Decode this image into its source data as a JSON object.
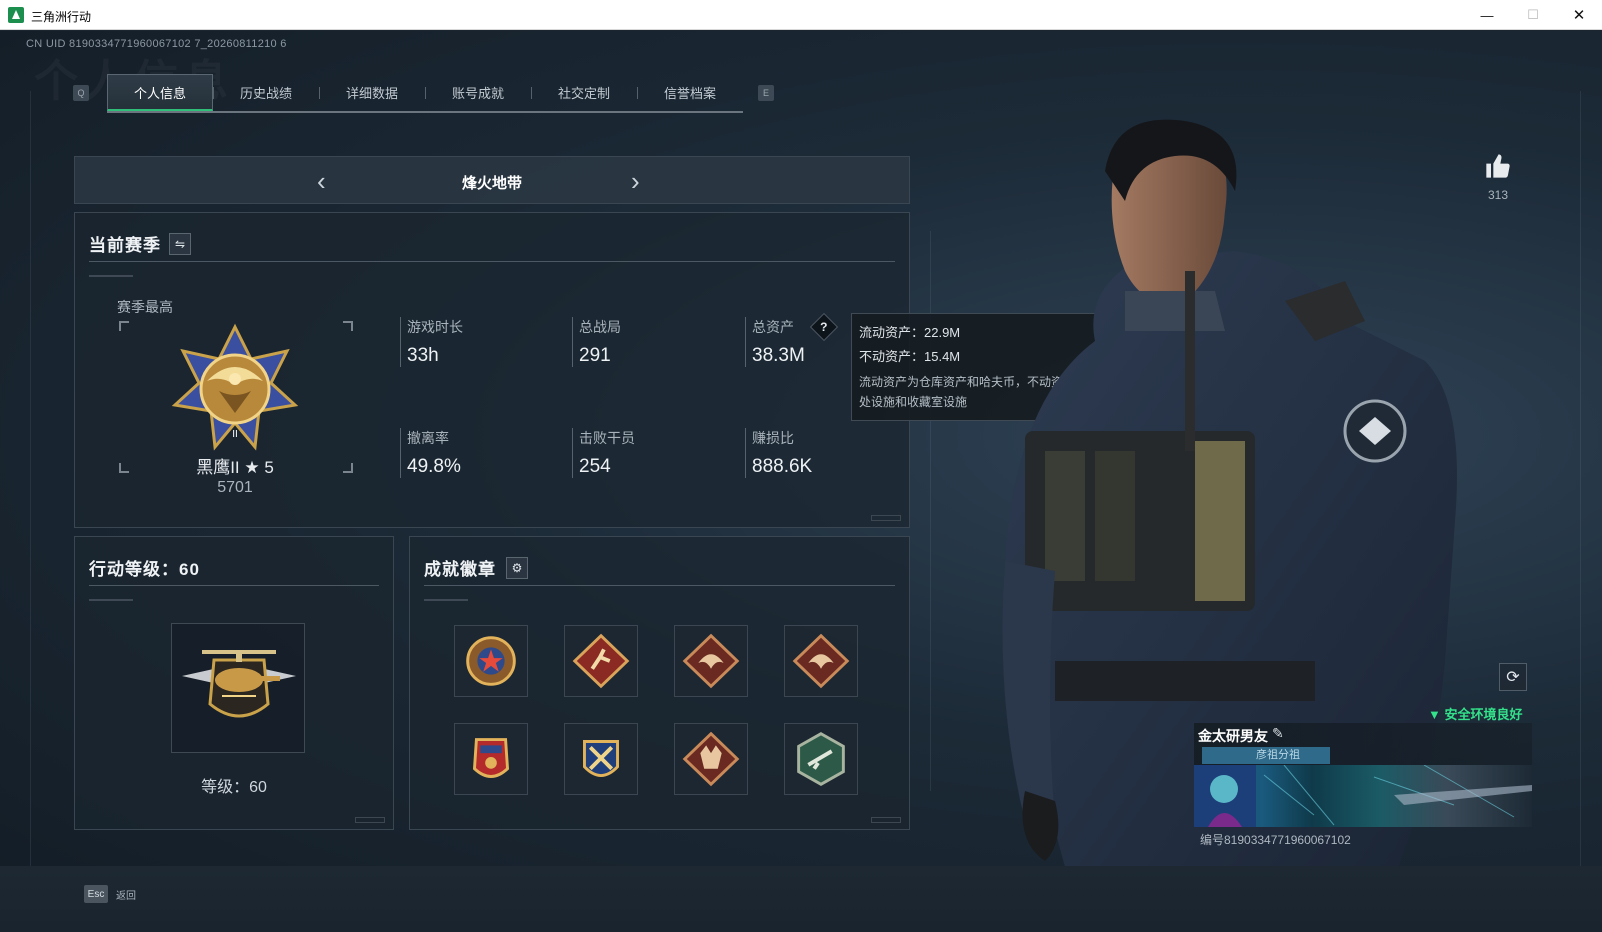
{
  "window": {
    "title": "三角洲行动",
    "min": "—",
    "max": "☐",
    "close": "✕"
  },
  "uid": "CN UID 8190334771960067102 7_20260811210 6",
  "watermark": "个人信息",
  "tabs": {
    "key_prev": "Q",
    "key_next": "E",
    "items": [
      {
        "label": "个人信息",
        "active": true
      },
      {
        "label": "历史战绩"
      },
      {
        "label": "详细数据"
      },
      {
        "label": "账号成就"
      },
      {
        "label": "社交定制"
      },
      {
        "label": "信誉档案"
      }
    ]
  },
  "mode": {
    "title": "烽火地带",
    "prev": "‹",
    "next": "›"
  },
  "season": {
    "title": "当前赛季",
    "swap_icon": "⇋",
    "best_label": "赛季最高",
    "rank_name": "黑鹰II ★ 5",
    "rank_score": "5701",
    "stats": [
      {
        "label": "游戏时长",
        "value": "33h"
      },
      {
        "label": "总战局",
        "value": "291"
      },
      {
        "label": "总资产",
        "value": "38.3M"
      },
      {
        "label": "撤离率",
        "value": "49.8%"
      },
      {
        "label": "击败干员",
        "value": "254"
      },
      {
        "label": "赚损比",
        "value": "888.6K"
      }
    ],
    "help": "?"
  },
  "tooltip": {
    "liquid": "流动资产：22.9M",
    "fixed": "不动资产：15.4M",
    "desc": "流动资产为仓库资产和哈夫币，不动资产为特勤处设施和收藏室设施"
  },
  "level": {
    "title": "行动等级：60",
    "text": "等级：60",
    "value": 60
  },
  "badges": {
    "title": "成就徽章",
    "settings_icon": "⚙",
    "items": [
      "star-shield-badge",
      "runner-badge",
      "dragon-badge",
      "dragon-badge-2",
      "eagle-shield-badge",
      "crossed-swords-badge",
      "wolf-badge",
      "hex-gun-badge"
    ]
  },
  "likes": {
    "count": "313"
  },
  "card": {
    "name": "金太研男友",
    "tag": "彦祖分祖",
    "id": "编号8190334771960067102",
    "status": "安全环境良好"
  },
  "bottom": {
    "esc": "Esc",
    "back": "返回"
  },
  "colors": {
    "accent": "#2fbf78",
    "safe": "#33e28a"
  }
}
